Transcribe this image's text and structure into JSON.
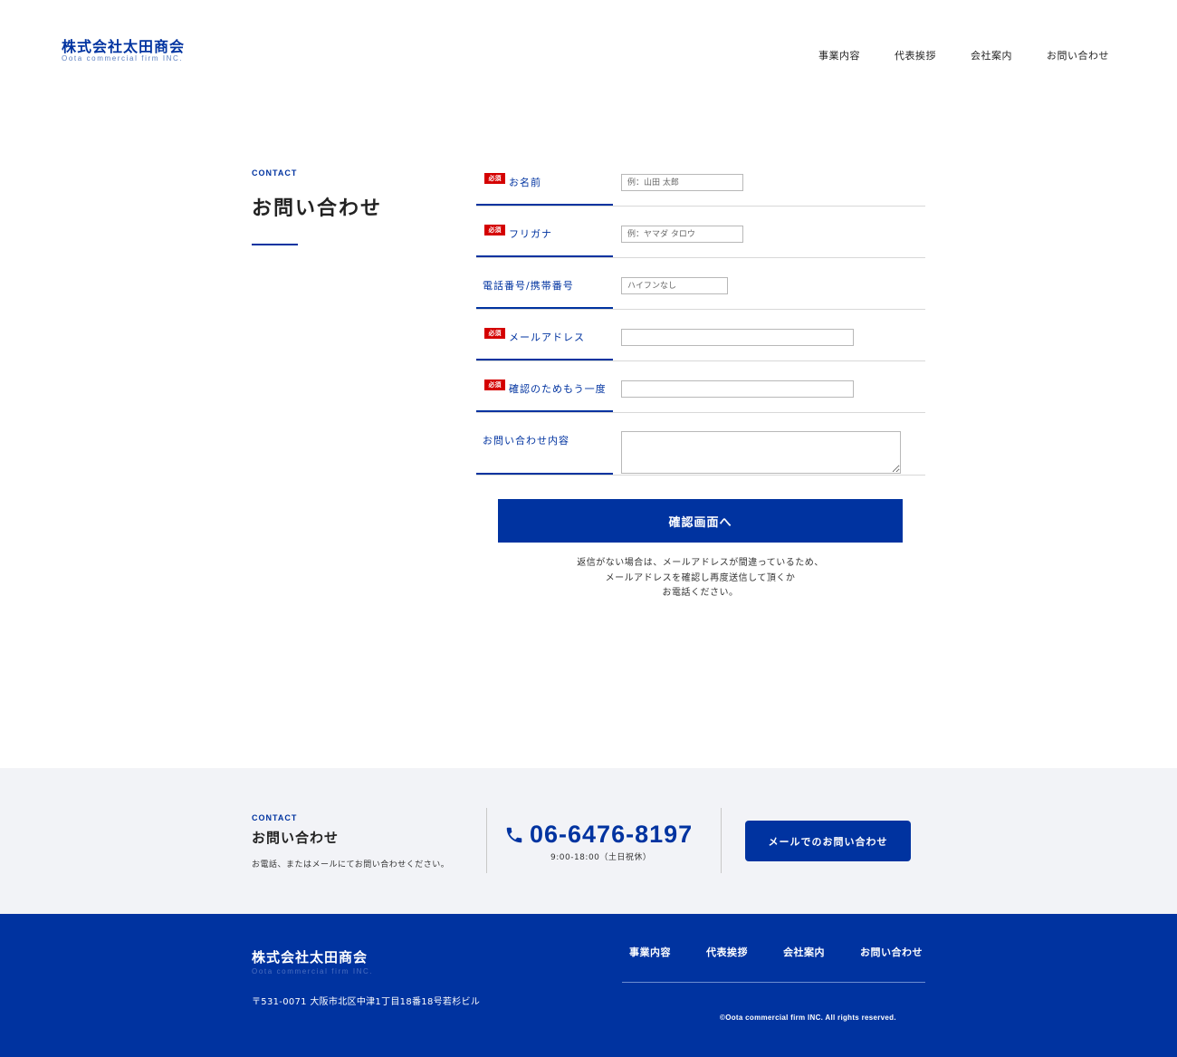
{
  "header": {
    "logo_ja": "株式会社太田商会",
    "logo_en": "Oota commercial firm INC.",
    "nav": [
      "事業内容",
      "代表挨拶",
      "会社案内",
      "お問い合わせ"
    ]
  },
  "heading": {
    "eyebrow": "CONTACT",
    "title": "お問い合わせ"
  },
  "form": {
    "required_badge": "必須",
    "fields": [
      {
        "label": "お名前",
        "required": true,
        "placeholder": "例：山田 太郎",
        "value": ""
      },
      {
        "label": "フリガナ",
        "required": true,
        "placeholder": "例：ヤマダ タロウ",
        "value": ""
      },
      {
        "label": "電話番号/携帯番号",
        "required": false,
        "placeholder": "ハイフンなし",
        "value": ""
      },
      {
        "label": "メールアドレス",
        "required": true,
        "placeholder": "",
        "value": ""
      },
      {
        "label": "確認のためもう一度",
        "required": true,
        "placeholder": "",
        "value": ""
      },
      {
        "label": "お問い合わせ内容",
        "required": false,
        "placeholder": "",
        "value": ""
      }
    ],
    "submit_label": "確認画面へ",
    "note_lines": [
      "返信がない場合は、メールアドレスが間違っているため、",
      "メールアドレスを確認し再度送信して頂くか",
      "お電話ください。"
    ]
  },
  "contact_band": {
    "eyebrow": "CONTACT",
    "title": "お問い合わせ",
    "description": "お電話、またはメールにてお問い合わせください。",
    "phone_icon": "phone-icon",
    "phone": "06-6476-8197",
    "hours": "9:00-18:00（土日祝休）",
    "mail_button": "メールでのお問い合わせ"
  },
  "footer": {
    "logo_ja": "株式会社太田商会",
    "logo_en": "Oota commercial firm INC.",
    "address": "〒531-0071 大阪市北区中津1丁目18番18号若杉ビル",
    "nav": [
      "事業内容",
      "代表挨拶",
      "会社案内",
      "お問い合わせ"
    ],
    "copyright": "©Oota commercial firm INC. All rights reserved."
  },
  "colors": {
    "brand": "#0033a0",
    "required": "#d40000",
    "band_bg": "#f2f3f7"
  }
}
